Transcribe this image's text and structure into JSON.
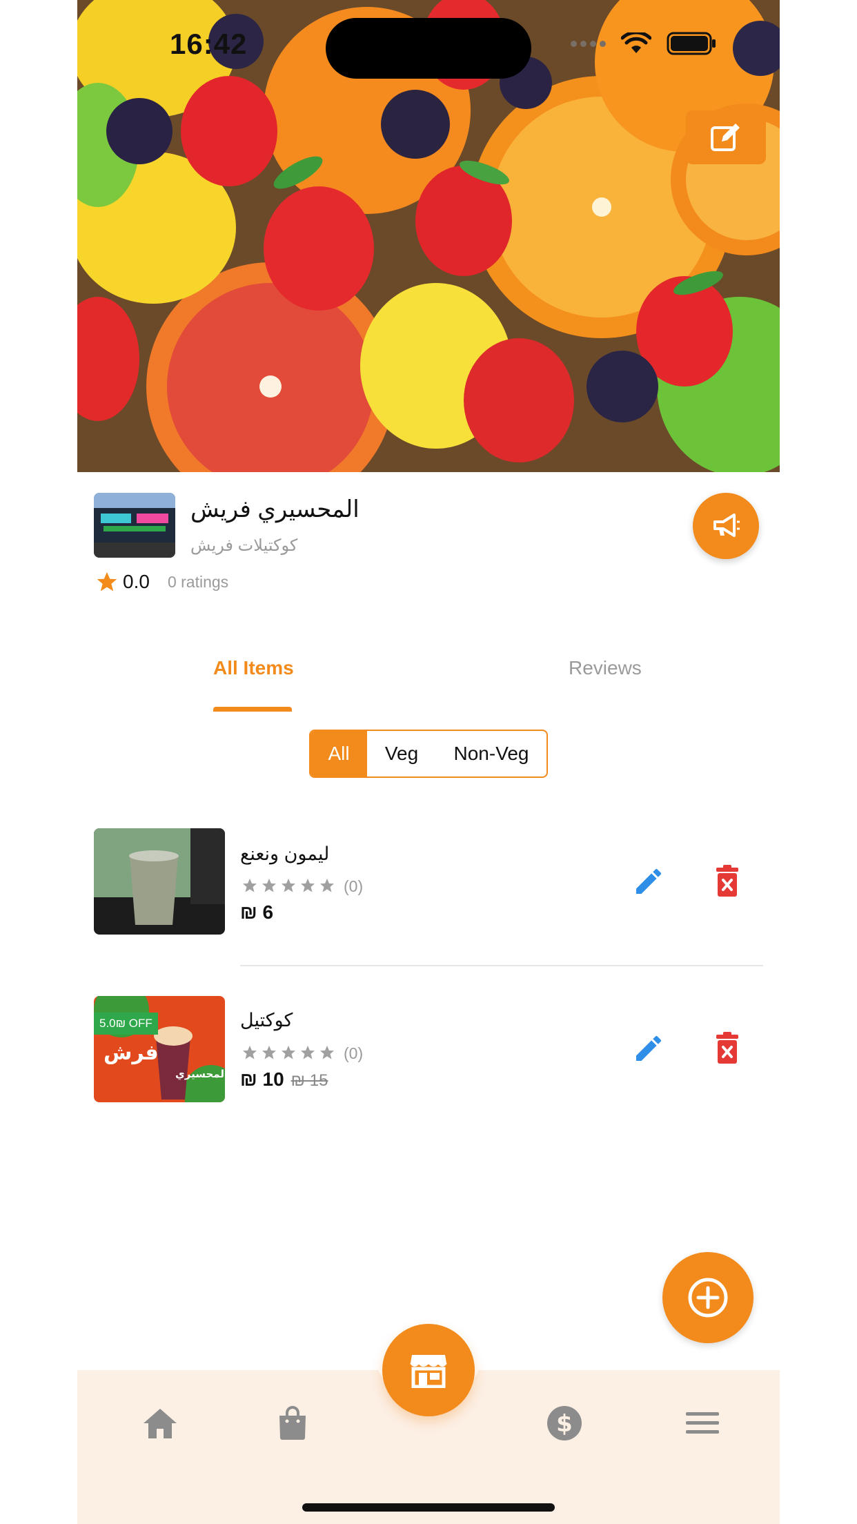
{
  "status_bar": {
    "time": "16:42"
  },
  "store": {
    "name": "المحسيري فريش",
    "subtitle": "كوكتيلات فريش",
    "rating": "0.0",
    "ratings_count": "0 ratings"
  },
  "tabs": [
    {
      "label": "All Items",
      "active": true
    },
    {
      "label": "Reviews",
      "active": false
    }
  ],
  "filter": {
    "options": [
      "All",
      "Veg",
      "Non-Veg"
    ],
    "selected": "All"
  },
  "items": [
    {
      "name": "ليمون ونعنع",
      "rating_count": "(0)",
      "price": "₪ 6",
      "old_price": "",
      "discount_badge": ""
    },
    {
      "name": "كوكتيل",
      "rating_count": "(0)",
      "price": "₪ 10",
      "old_price": "₪ 15",
      "discount_badge": "5.0₪ OFF"
    }
  ],
  "colors": {
    "accent": "#f28a1c",
    "edit_icon": "#2f8fe8",
    "delete_icon": "#e53935",
    "nav_background": "#fcefe4",
    "muted_text": "#9a9a9a"
  },
  "icons": {
    "hero_edit": "edit-square-icon",
    "promo": "megaphone-icon",
    "add": "plus-circle-icon",
    "nav": [
      "home-icon",
      "shopping-bag-icon",
      "store-icon",
      "dollar-icon",
      "menu-icon"
    ]
  }
}
